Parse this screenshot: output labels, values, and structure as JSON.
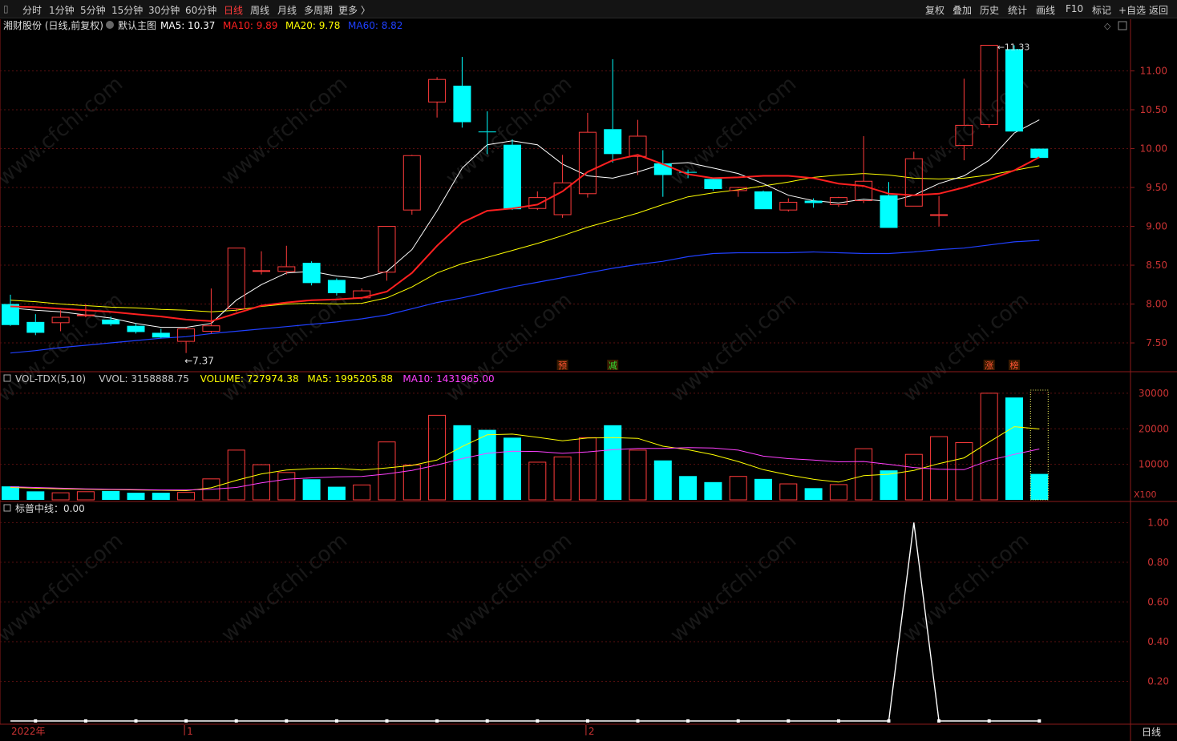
{
  "topbar": {
    "periods": [
      {
        "label": "分时",
        "active": false
      },
      {
        "label": "1分钟",
        "active": false
      },
      {
        "label": "5分钟",
        "active": false
      },
      {
        "label": "15分钟",
        "active": false
      },
      {
        "label": "30分钟",
        "active": false
      },
      {
        "label": "60分钟",
        "active": false
      },
      {
        "label": "日线",
        "active": true
      },
      {
        "label": "周线",
        "active": false
      },
      {
        "label": "月线",
        "active": false
      },
      {
        "label": "多周期",
        "active": false
      },
      {
        "label": "更多 〉",
        "active": false
      }
    ],
    "tools": [
      "复权",
      "叠加",
      "历史",
      "统计",
      "画线",
      "F10",
      "标记",
      "+自选",
      "返回"
    ]
  },
  "main_panel": {
    "title": "湘财股份 (日线,前复权)",
    "indicator_name": "默认主图",
    "ma_labels": [
      {
        "text": "MA5: 10.37",
        "color": "#ffffff"
      },
      {
        "text": "MA10: 9.89",
        "color": "#ff2020"
      },
      {
        "text": "MA20: 9.78",
        "color": "#ffff00"
      },
      {
        "text": "MA60: 8.82",
        "color": "#2040ff"
      }
    ],
    "low_marker": "7.37",
    "high_marker": "11.33",
    "event_tags": [
      {
        "text": "预",
        "index": 22
      },
      {
        "text": "减",
        "index": 24
      },
      {
        "text": "涨",
        "index": 39
      },
      {
        "text": "榜",
        "index": 40
      }
    ]
  },
  "vol_panel": {
    "labels": [
      {
        "text": "VOL-TDX(5,10)",
        "color": "#c8c8c8"
      },
      {
        "text": "VVOL: 3158888.75",
        "color": "#c8c8c8"
      },
      {
        "text": "VOLUME: 727974.38",
        "color": "#ffff00"
      },
      {
        "text": "MA5: 1995205.88",
        "color": "#ffff00"
      },
      {
        "text": "MA10: 1431965.00",
        "color": "#ff40ff"
      }
    ],
    "unit": "X100"
  },
  "ind_panel": {
    "label": "标普中线：0.00"
  },
  "time_axis": {
    "year_label": "2022年",
    "month_labels": [
      {
        "text": "1",
        "index": 7
      },
      {
        "text": "2",
        "index": 23
      }
    ],
    "bottom_period": "日线"
  },
  "watermark": "www.cfchi.com",
  "colors": {
    "up": "#ff3b3b",
    "down": "#00ffff",
    "ma5": "#ffffff",
    "ma10": "#ff2020",
    "ma20": "#ffff00",
    "ma60": "#2040ff",
    "vma10": "#ff40ff"
  },
  "chart_data": {
    "type": "candlestick",
    "y_ticks_price": [
      7.5,
      8.0,
      8.5,
      9.0,
      9.5,
      10.0,
      10.5,
      11.0
    ],
    "ylim_price": [
      7.15,
      11.5
    ],
    "y_ticks_volume": [
      10000,
      20000,
      30000
    ],
    "ylim_volume": [
      0,
      32000
    ],
    "y_ticks_indicator": [
      0.2,
      0.4,
      0.6,
      0.8,
      1.0
    ],
    "ylim_indicator": [
      0,
      1.05
    ],
    "candles": [
      [
        8.0,
        8.12,
        7.72,
        7.73
      ],
      [
        7.77,
        7.87,
        7.6,
        7.63
      ],
      [
        7.76,
        7.92,
        7.65,
        7.83
      ],
      [
        7.85,
        8.0,
        7.83,
        7.86
      ],
      [
        7.8,
        7.84,
        7.72,
        7.74
      ],
      [
        7.72,
        7.75,
        7.62,
        7.64
      ],
      [
        7.63,
        7.68,
        7.56,
        7.57
      ],
      [
        7.52,
        7.7,
        7.37,
        7.68
      ],
      [
        7.65,
        8.2,
        7.62,
        7.72
      ],
      [
        7.94,
        8.72,
        7.9,
        8.72
      ],
      [
        8.43,
        8.68,
        8.38,
        8.43
      ],
      [
        8.42,
        8.75,
        8.38,
        8.48
      ],
      [
        8.53,
        8.55,
        8.24,
        8.27
      ],
      [
        8.31,
        8.33,
        8.11,
        8.14
      ],
      [
        8.08,
        8.2,
        8.06,
        8.17
      ],
      [
        8.41,
        9.0,
        8.3,
        9.0
      ],
      [
        9.21,
        9.92,
        9.15,
        9.91
      ],
      [
        10.6,
        10.92,
        10.4,
        10.89
      ],
      [
        10.81,
        11.18,
        10.27,
        10.34
      ],
      [
        10.22,
        10.48,
        9.93,
        10.21
      ],
      [
        10.05,
        10.12,
        9.21,
        9.22
      ],
      [
        9.23,
        9.45,
        9.21,
        9.37
      ],
      [
        9.15,
        9.92,
        9.11,
        9.56
      ],
      [
        9.42,
        10.46,
        9.37,
        10.21
      ],
      [
        10.25,
        11.15,
        9.82,
        9.93
      ],
      [
        9.9,
        10.37,
        9.66,
        10.16
      ],
      [
        9.81,
        9.98,
        9.38,
        9.66
      ],
      [
        9.7,
        9.73,
        9.62,
        9.69
      ],
      [
        9.61,
        9.62,
        9.46,
        9.48
      ],
      [
        9.46,
        9.49,
        9.38,
        9.5
      ],
      [
        9.45,
        9.46,
        9.22,
        9.22
      ],
      [
        9.21,
        9.36,
        9.19,
        9.31
      ],
      [
        9.33,
        9.36,
        9.24,
        9.3
      ],
      [
        9.28,
        9.38,
        9.25,
        9.37
      ],
      [
        9.33,
        10.16,
        9.3,
        9.58
      ],
      [
        9.4,
        9.57,
        8.98,
        8.98
      ],
      [
        9.26,
        9.96,
        9.26,
        9.87
      ],
      [
        9.15,
        9.39,
        9.0,
        9.15
      ],
      [
        10.04,
        10.9,
        9.85,
        10.3
      ],
      [
        10.31,
        11.33,
        10.27,
        11.33
      ],
      [
        11.28,
        11.33,
        10.22,
        10.22
      ],
      [
        10.0,
        10.0,
        9.88,
        9.88
      ]
    ],
    "ma5": [
      7.95,
      7.92,
      7.9,
      7.86,
      7.82,
      7.75,
      7.7,
      7.7,
      7.75,
      8.05,
      8.25,
      8.4,
      8.42,
      8.36,
      8.33,
      8.42,
      8.7,
      9.2,
      9.75,
      10.05,
      10.1,
      10.05,
      9.8,
      9.65,
      9.62,
      9.7,
      9.8,
      9.82,
      9.75,
      9.68,
      9.55,
      9.4,
      9.33,
      9.3,
      9.35,
      9.32,
      9.4,
      9.55,
      9.65,
      9.85,
      10.2,
      10.37
    ],
    "ma10": [
      7.97,
      7.96,
      7.94,
      7.92,
      7.9,
      7.87,
      7.84,
      7.8,
      7.78,
      7.88,
      7.98,
      8.02,
      8.05,
      8.06,
      8.08,
      8.16,
      8.4,
      8.75,
      9.05,
      9.2,
      9.23,
      9.28,
      9.45,
      9.7,
      9.85,
      9.92,
      9.8,
      9.67,
      9.62,
      9.63,
      9.65,
      9.65,
      9.62,
      9.55,
      9.52,
      9.42,
      9.4,
      9.42,
      9.5,
      9.6,
      9.72,
      9.89
    ],
    "ma20": [
      8.05,
      8.03,
      8.0,
      7.98,
      7.96,
      7.95,
      7.93,
      7.92,
      7.9,
      7.92,
      7.97,
      8.0,
      8.01,
      8.0,
      8.01,
      8.08,
      8.22,
      8.4,
      8.52,
      8.6,
      8.69,
      8.78,
      8.88,
      8.99,
      9.08,
      9.17,
      9.28,
      9.38,
      9.43,
      9.47,
      9.52,
      9.57,
      9.63,
      9.66,
      9.68,
      9.66,
      9.62,
      9.61,
      9.62,
      9.66,
      9.72,
      9.78
    ],
    "ma60": [
      7.37,
      7.4,
      7.44,
      7.47,
      7.5,
      7.53,
      7.56,
      7.58,
      7.62,
      7.65,
      7.68,
      7.71,
      7.74,
      7.77,
      7.81,
      7.86,
      7.94,
      8.02,
      8.08,
      8.15,
      8.22,
      8.28,
      8.34,
      8.4,
      8.46,
      8.51,
      8.55,
      8.61,
      8.65,
      8.66,
      8.66,
      8.66,
      8.67,
      8.66,
      8.65,
      8.65,
      8.67,
      8.7,
      8.72,
      8.76,
      8.8,
      8.82
    ],
    "volume": [
      3800,
      2400,
      2000,
      2300,
      2500,
      2000,
      2000,
      2100,
      5900,
      14000,
      9900,
      7700,
      5800,
      3700,
      4200,
      16300,
      9800,
      23800,
      21000,
      19700,
      17500,
      10600,
      12100,
      17500,
      21000,
      14000,
      11100,
      6700,
      5000,
      6600,
      5900,
      4500,
      3300,
      4300,
      14400,
      8300,
      12800,
      17800,
      16100,
      30000,
      28800,
      7300
    ],
    "vol_ma5": [
      3500,
      3300,
      3100,
      3000,
      2900,
      2800,
      2700,
      2600,
      3400,
      5500,
      7300,
      8400,
      8800,
      8900,
      8400,
      9000,
      9700,
      11200,
      15000,
      18300,
      18500,
      17600,
      16600,
      17400,
      17500,
      17300,
      15100,
      14100,
      12700,
      10800,
      8500,
      7000,
      5800,
      5000,
      6800,
      7200,
      8300,
      10200,
      11800,
      16300,
      20600,
      19952
    ],
    "vol_ma10": [
      3700,
      3500,
      3300,
      3100,
      3000,
      2900,
      2800,
      2800,
      3000,
      3500,
      4800,
      5800,
      6200,
      6500,
      6600,
      7300,
      8300,
      9800,
      11600,
      13100,
      13700,
      13600,
      13100,
      13500,
      14100,
      14500,
      14500,
      14700,
      14600,
      14000,
      12300,
      11600,
      11200,
      10700,
      10800,
      10000,
      9100,
      8600,
      8500,
      11100,
      12800,
      14320
    ],
    "indicator": [
      0,
      0,
      0,
      0,
      0,
      0,
      0,
      0,
      0,
      0,
      0,
      0,
      0,
      0,
      0,
      0,
      0,
      0,
      0,
      0,
      0,
      0,
      0,
      0,
      0,
      0,
      0,
      0,
      0,
      0,
      0,
      0,
      0,
      0,
      0,
      0,
      1,
      0,
      0,
      0,
      0,
      0
    ]
  }
}
